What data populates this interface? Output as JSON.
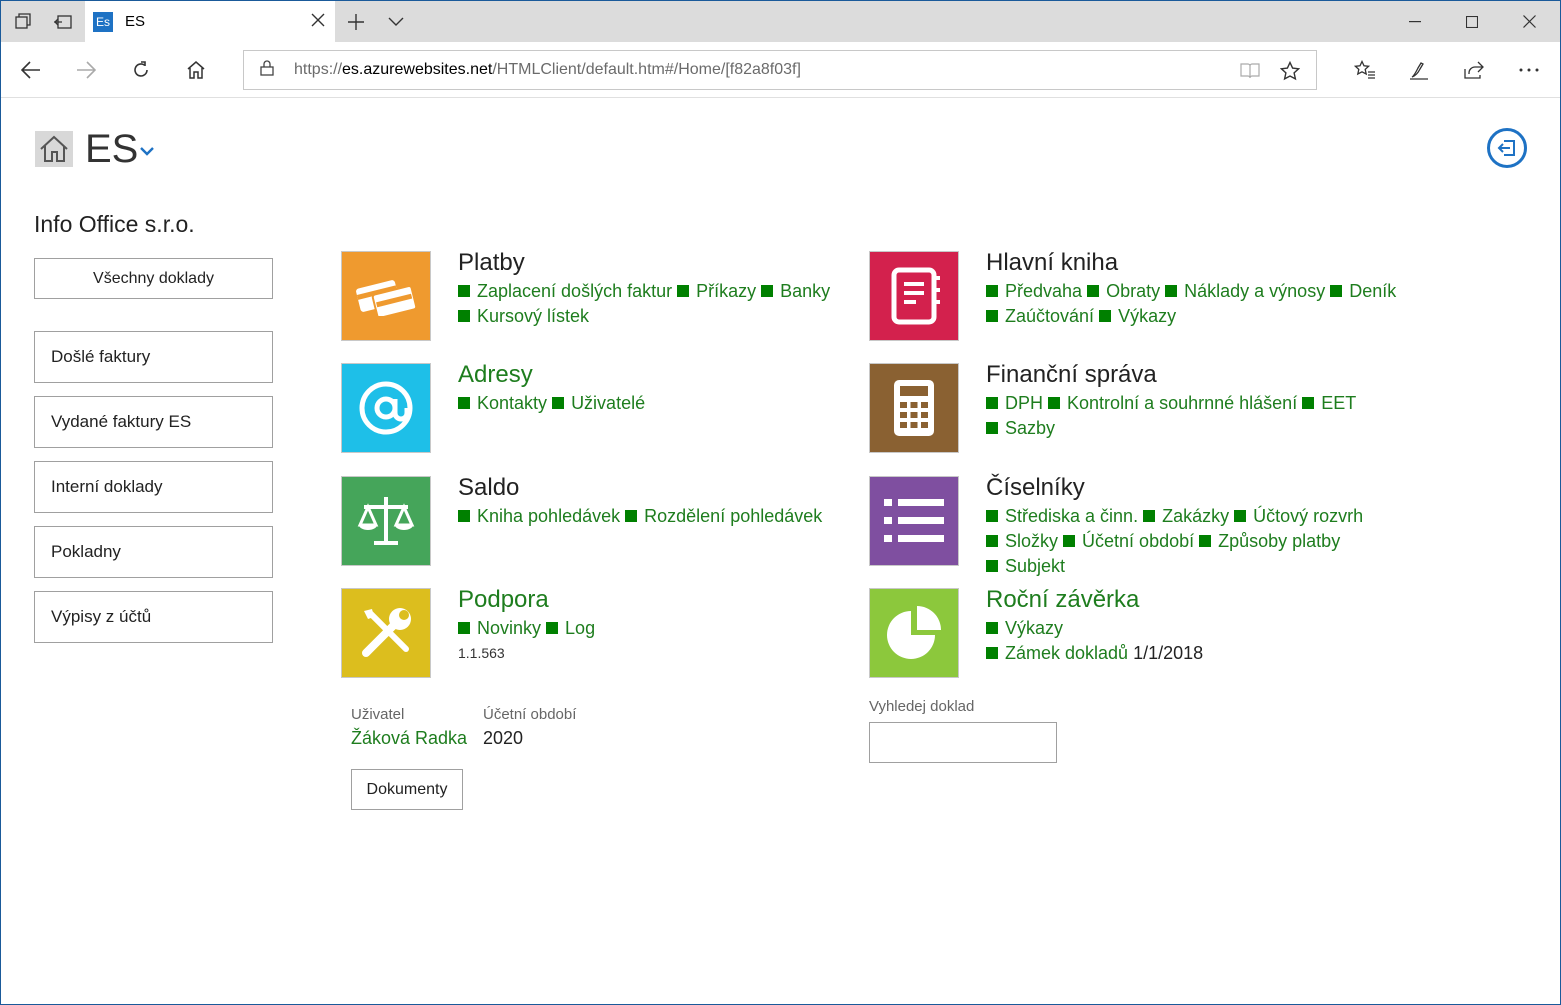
{
  "browser": {
    "tab_title": "ES",
    "favicon_text": "Es",
    "url_prefix": "https://",
    "url_host": "es.azurewebsites.net",
    "url_path": "/HTMLClient/default.htm#/Home/[f82a8f03f]"
  },
  "header": {
    "app_title": "ES"
  },
  "sidebar": {
    "company": "Info Office s.r.o.",
    "all_docs": "Všechny doklady",
    "items": [
      "Došlé faktury",
      "Vydané faktury ES",
      "Interní doklady",
      "Pokladny",
      "Výpisy z účtů"
    ]
  },
  "tiles": {
    "platby": {
      "title": "Platby",
      "color": "#ef9a2f",
      "links": [
        "Zaplacení došlých faktur",
        "Příkazy",
        "Banky",
        "Kursový lístek"
      ]
    },
    "adresy": {
      "title": "Adresy",
      "color": "#1ebfe8",
      "links": [
        "Kontakty",
        "Uživatelé"
      ]
    },
    "saldo": {
      "title": "Saldo",
      "color": "#45a55a",
      "links": [
        "Kniha pohledávek",
        "Rozdělení pohledávek"
      ]
    },
    "podpora": {
      "title": "Podpora",
      "color": "#dcbe1e",
      "links": [
        "Novinky",
        "Log"
      ],
      "version": "1.1.563"
    },
    "hlavni_kniha": {
      "title": "Hlavní kniha",
      "color": "#d3214d",
      "links": [
        "Předvaha",
        "Obraty",
        "Náklady a výnosy",
        "Deník",
        "Zaúčtování",
        "Výkazy"
      ]
    },
    "financni_sprava": {
      "title": "Finanční správa",
      "color": "#8a6132",
      "links": [
        "DPH",
        "Kontrolní a souhrnné hlášení",
        "EET",
        "Sazby"
      ]
    },
    "ciselniky": {
      "title": "Číselníky",
      "color": "#7f4fa0",
      "links": [
        "Střediska a činn.",
        "Zakázky",
        "Účtový rozvrh",
        "Složky",
        "Účetní období",
        "Způsoby platby",
        "Subjekt"
      ]
    },
    "rocni_zaverka": {
      "title": "Roční závěrka",
      "color": "#8cc83c",
      "links": [
        "Výkazy",
        "Zámek dokladů"
      ],
      "lock_date": "1/1/2018"
    }
  },
  "footer": {
    "user_label": "Uživatel",
    "user_value": "Žáková Radka",
    "period_label": "Účetní období",
    "period_value": "2020",
    "documents_button": "Dokumenty",
    "search_label": "Vyhledej doklad",
    "search_value": ""
  }
}
